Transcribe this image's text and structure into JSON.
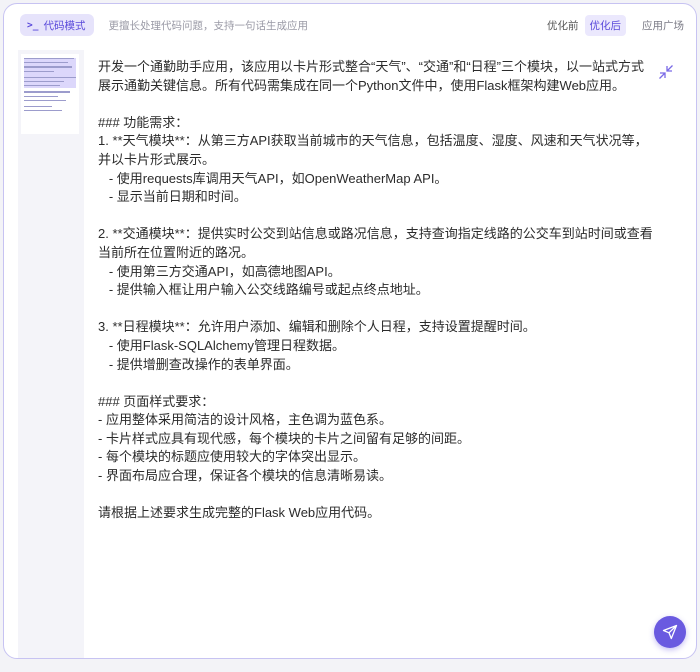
{
  "header": {
    "mode_icon": ">_",
    "mode_label": "代码模式",
    "subtitle": "更擅长处理代码问题，支持一句话生成应用",
    "toggle_before": "优化前",
    "toggle_after": "优化后",
    "plaza": "应用广场"
  },
  "icons": {
    "collapse": "collapse-arrows-icon",
    "send": "paper-plane-icon"
  },
  "colors": {
    "accent": "#6a5ae0",
    "accent_light": "#e6e3fb",
    "border": "#c7c3f2"
  },
  "content": {
    "text": "开发一个通勤助手应用，该应用以卡片形式整合“天气”、“交通”和“日程”三个模块，以一站式方式展示通勤关键信息。所有代码需集成在同一个Python文件中，使用Flask框架构建Web应用。\n\n### 功能需求：\n1. **天气模块**：从第三方API获取当前城市的天气信息，包括温度、湿度、风速和天气状况等，并以卡片形式展示。\n   - 使用requests库调用天气API，如OpenWeatherMap API。\n   - 显示当前日期和时间。\n\n2. **交通模块**：提供实时公交到站信息或路况信息，支持查询指定线路的公交车到站时间或查看当前所在位置附近的路况。\n   - 使用第三方交通API，如高德地图API。\n   - 提供输入框让用户输入公交线路编号或起点终点地址。\n\n3. **日程模块**：允许用户添加、编辑和删除个人日程，支持设置提醒时间。\n   - 使用Flask-SQLAlchemy管理日程数据。\n   - 提供增删查改操作的表单界面。\n\n### 页面样式要求：\n- 应用整体采用简洁的设计风格，主色调为蓝色系。\n- 卡片样式应具有现代感，每个模块的卡片之间留有足够的间距。\n- 每个模块的标题应使用较大的字体突出显示。\n- 界面布局应合理，保证各个模块的信息清晰易读。\n\n请根据上述要求生成完整的Flask Web应用代码。"
  }
}
